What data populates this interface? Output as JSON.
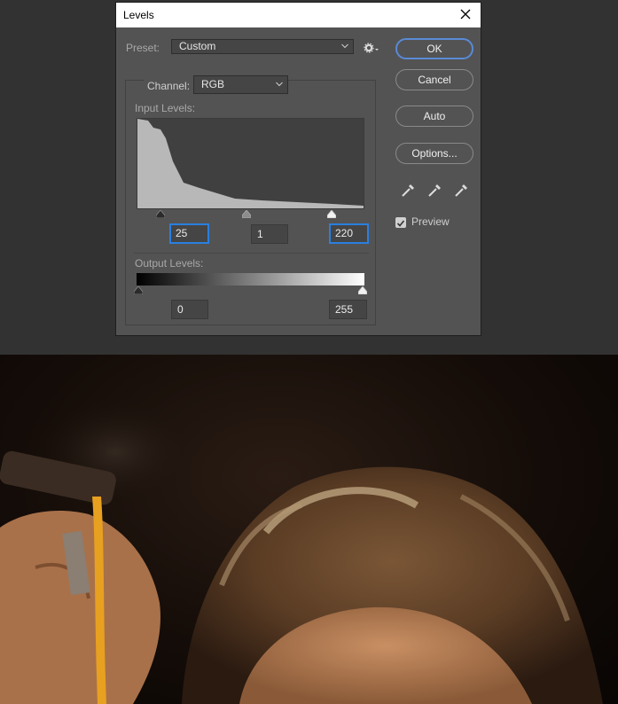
{
  "dialog": {
    "title": "Levels",
    "preset_label": "Preset:",
    "preset_value": "Custom",
    "channel_label": "Channel:",
    "channel_value": "RGB",
    "input_levels_label": "Input Levels:",
    "input_black": "25",
    "input_gamma": "1",
    "input_white": "220",
    "output_levels_label": "Output Levels:",
    "output_black": "0",
    "output_white": "255",
    "buttons": {
      "ok": "OK",
      "cancel": "Cancel",
      "auto": "Auto",
      "options": "Options..."
    },
    "preview_label": "Preview",
    "preview_checked": true,
    "accent_color": "#2a7fe0"
  }
}
